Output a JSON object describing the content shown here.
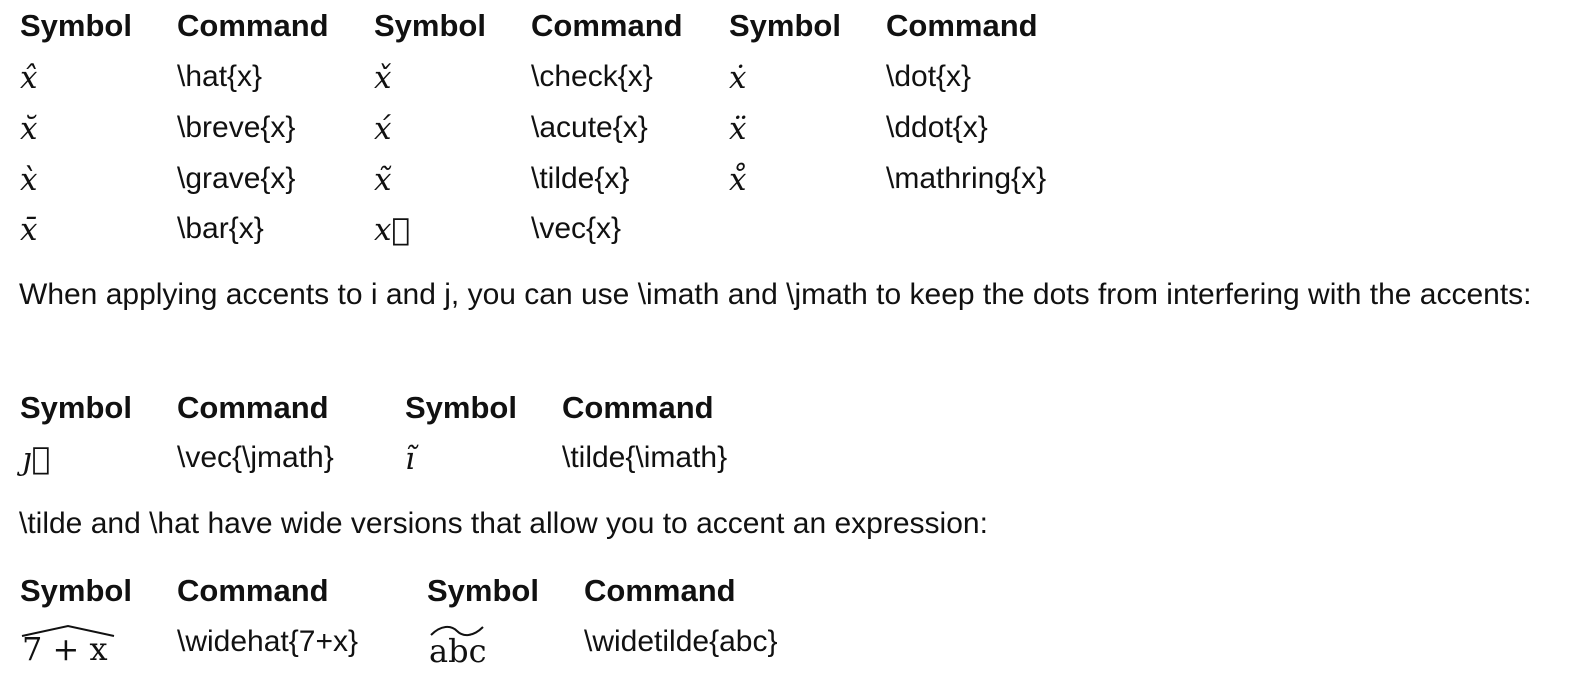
{
  "tables": {
    "accents": {
      "headers": [
        "Symbol",
        "Command",
        "Symbol",
        "Command",
        "Symbol",
        "Command"
      ],
      "rows": [
        [
          "x̂",
          "\\hat{x}",
          "x̌",
          "\\check{x}",
          "ẋ",
          "\\dot{x}"
        ],
        [
          "x̆",
          "\\breve{x}",
          "x́",
          "\\acute{x}",
          "ẍ",
          "\\ddot{x}"
        ],
        [
          "x̀",
          "\\grave{x}",
          "x̃",
          "\\tilde{x}",
          "x̊",
          "\\mathring{x}"
        ],
        [
          "x̄",
          "\\bar{x}",
          "x⃗",
          "\\vec{x}",
          "",
          ""
        ]
      ]
    },
    "dotless": {
      "headers": [
        "Symbol",
        "Command",
        "Symbol",
        "Command"
      ],
      "rows": [
        [
          "ȷ⃗",
          "\\vec{\\jmath}",
          "ı̃",
          "\\tilde{\\imath}"
        ]
      ]
    },
    "wide": {
      "headers": [
        "Symbol",
        "Command",
        "Symbol",
        "Command"
      ],
      "rows": [
        [
          "7 + x",
          "\\widehat{7+x}",
          "abc",
          "\\widetilde{abc}"
        ]
      ]
    }
  },
  "paragraphs": {
    "imath_note": "When applying accents to i and j, you can use \\imath and \\jmath to keep the dots from interfering with the accents:",
    "wide_note": "\\tilde and \\hat have wide versions that allow you to accent an expression:"
  }
}
